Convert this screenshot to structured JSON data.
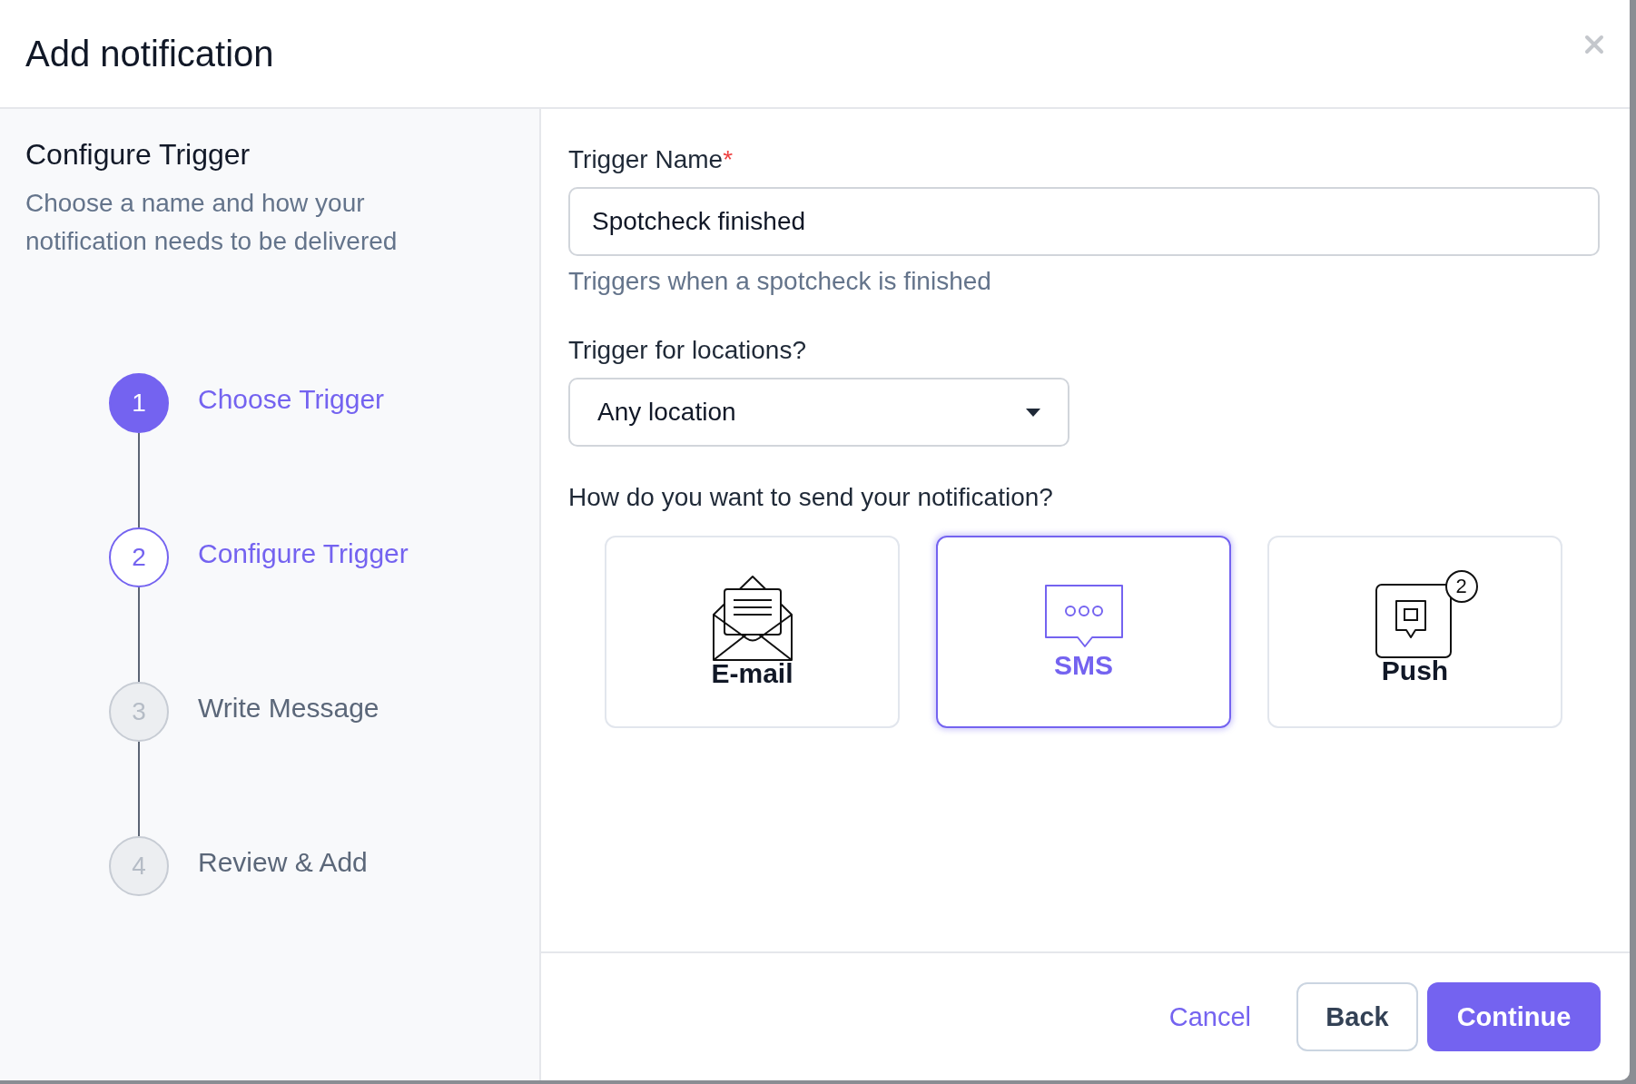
{
  "dialog": {
    "title": "Add notification"
  },
  "sidebar": {
    "title": "Configure Trigger",
    "description": "Choose a name and how your notification needs to be delivered",
    "steps": [
      {
        "number": "1",
        "label": "Choose Trigger",
        "completed": true,
        "active": false
      },
      {
        "number": "2",
        "label": "Configure Trigger",
        "completed": false,
        "active": true
      },
      {
        "number": "3",
        "label": "Write Message",
        "completed": false,
        "active": false
      },
      {
        "number": "4",
        "label": "Review & Add",
        "completed": false,
        "active": false
      }
    ]
  },
  "form": {
    "name_label": "Trigger Name",
    "required_mark": "*",
    "name_value": "Spotcheck finished",
    "name_hint": "Triggers when a spotcheck is finished",
    "location_label": "Trigger for locations?",
    "location_value": "Any location",
    "channel_label": "How do you want to send your notification?",
    "channels": [
      {
        "kind": "email",
        "label": "E-mail",
        "selected": false
      },
      {
        "kind": "sms",
        "label": "SMS",
        "selected": true
      },
      {
        "kind": "push",
        "label": "Push",
        "selected": false,
        "badge": "2"
      }
    ]
  },
  "footer": {
    "cancel": "Cancel",
    "back": "Back",
    "continue": "Continue"
  }
}
